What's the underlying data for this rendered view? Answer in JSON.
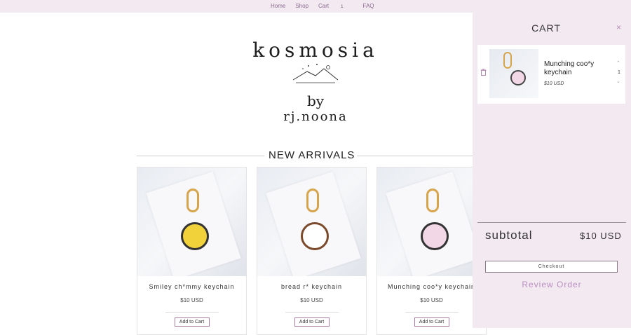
{
  "nav": {
    "home": "Home",
    "shop": "Shop",
    "cart": "Cart",
    "cart_count": "1",
    "faq": "FAQ"
  },
  "logo": {
    "brand": "kosmosia",
    "by": "by",
    "author": "rj.noona"
  },
  "section_title": "NEW ARRIVALS",
  "products": [
    {
      "name": "Smiley ch*mmy keychain",
      "price": "$10 USD",
      "button": "Add to Cart",
      "charm_color": "#f1d23a"
    },
    {
      "name": "bread r* keychain",
      "price": "$10 USD",
      "button": "Add to Cart",
      "charm_color": "#ffffff"
    },
    {
      "name": "Munching coo*y keychain",
      "price": "$10 USD",
      "button": "Add to Cart",
      "charm_color": "#f2d7e6"
    }
  ],
  "drawer": {
    "title": "CART",
    "close": "×",
    "item": {
      "name": "Munching coo*y keychain",
      "price": "$10 USD",
      "qty": "1"
    },
    "subtotal_label": "subtotal",
    "subtotal_value": "$10 USD",
    "checkout": "Checkout",
    "review": "Review Order"
  },
  "colors": {
    "accent": "#b88ec0",
    "drawer_bg": "#f3e9f1"
  }
}
